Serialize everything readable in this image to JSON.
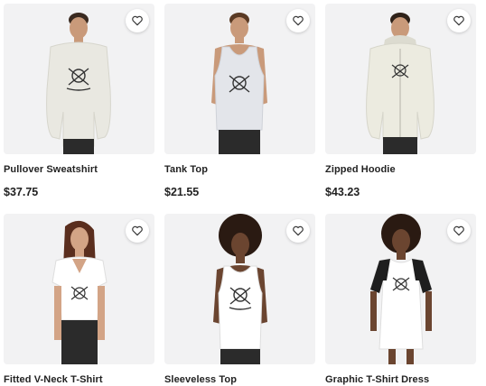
{
  "products": [
    {
      "title": "Pullover Sweatshirt",
      "price": "$37.75",
      "garment_color": "#e9e8e1",
      "icon": "heart-outline-icon"
    },
    {
      "title": "Tank Top",
      "price": "$21.55",
      "garment_color": "#e3e5ea",
      "icon": "heart-outline-icon"
    },
    {
      "title": "Zipped Hoodie",
      "price": "$43.23",
      "garment_color": "#ecebe0",
      "icon": "heart-outline-icon"
    },
    {
      "title": "Fitted V-Neck T-Shirt",
      "price": "",
      "garment_color": "#ffffff",
      "icon": "heart-outline-icon"
    },
    {
      "title": "Sleeveless Top",
      "price": "",
      "garment_color": "#ffffff",
      "icon": "heart-outline-icon"
    },
    {
      "title": "Graphic T-Shirt Dress",
      "price": "",
      "garment_color": "#ffffff",
      "icon": "heart-outline-icon"
    }
  ],
  "colors": {
    "card_bg": "#f2f2f3",
    "text": "#222222",
    "skin": "#c99a7a",
    "dark_skin": "#6b4530"
  }
}
